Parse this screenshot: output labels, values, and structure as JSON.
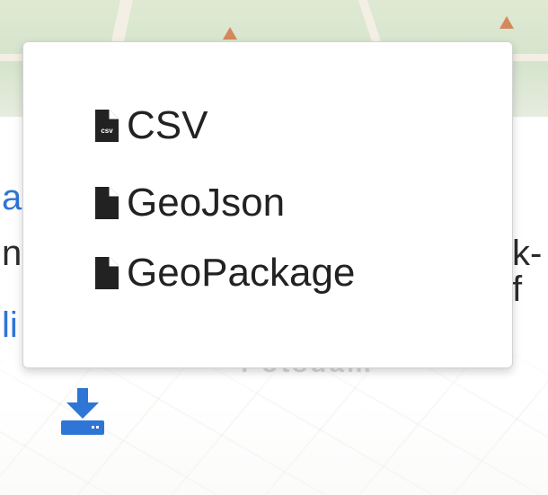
{
  "background": {
    "left_fragments": [
      "a",
      "n",
      "li"
    ],
    "right_fragment": "k-f",
    "city_label": "Potsdam"
  },
  "export_menu": {
    "items": [
      {
        "label": "CSV",
        "icon": "file-csv-icon",
        "icon_text": "csv"
      },
      {
        "label": "GeoJson",
        "icon": "file-icon"
      },
      {
        "label": "GeoPackage",
        "icon": "file-icon"
      }
    ]
  },
  "download_button": {
    "icon": "download-icon",
    "color": "#2f75d6"
  }
}
